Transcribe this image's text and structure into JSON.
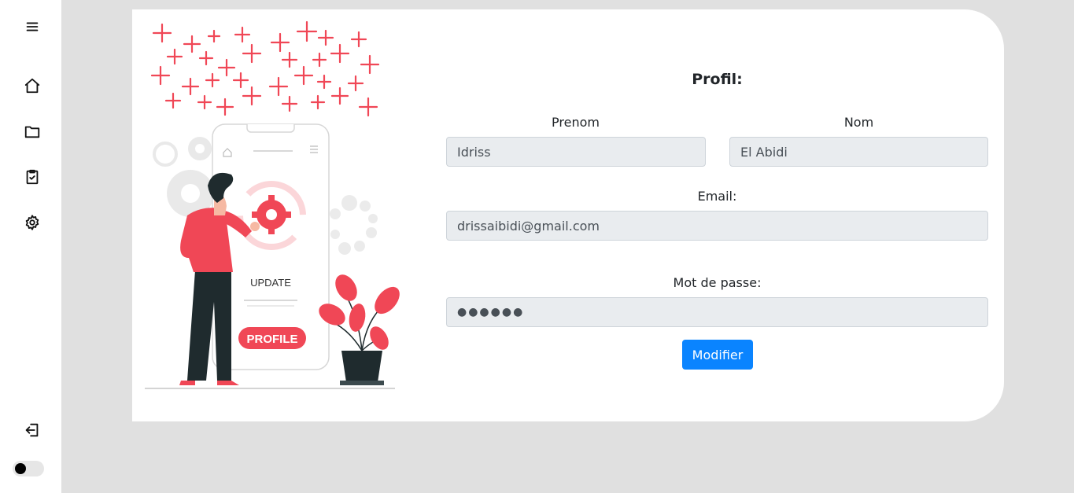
{
  "sidebar": {
    "icons": [
      "menu-icon",
      "home-icon",
      "folder-icon",
      "clipboard-check-icon",
      "gear-icon",
      "logout-icon"
    ],
    "theme_toggle": {
      "state": "off"
    }
  },
  "illustration": {
    "screen_text": "UPDATE",
    "badge_text": "PROFILE"
  },
  "form": {
    "title": "Profil:",
    "first_name": {
      "label": "Prenom",
      "value": "Idriss"
    },
    "last_name": {
      "label": "Nom",
      "value": "El Abidi"
    },
    "email": {
      "label": "Email:",
      "value": "drissaibidi@gmail.com"
    },
    "password": {
      "label": "Mot de passe:",
      "value": "●●●●●●"
    },
    "submit_label": "Modifier"
  },
  "colors": {
    "accent": "#0a84ff",
    "illustration_red": "#f04756",
    "background": "#e0e0e0"
  }
}
